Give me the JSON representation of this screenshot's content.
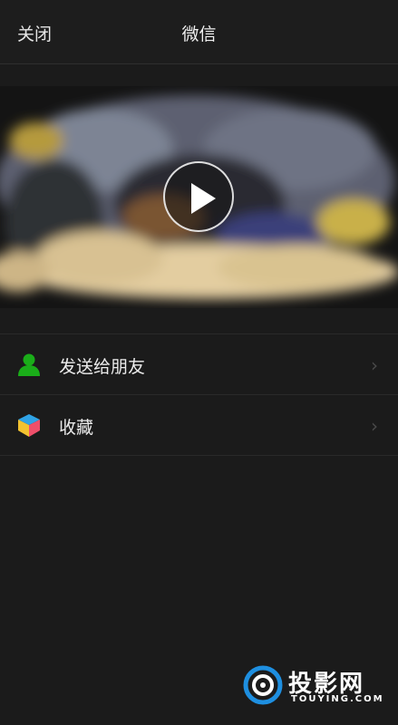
{
  "header": {
    "close_label": "关闭",
    "title": "微信"
  },
  "video": {
    "play_icon": "play-icon"
  },
  "menu": {
    "items": [
      {
        "label": "发送给朋友",
        "icon": "user-icon",
        "chevron": "›"
      },
      {
        "label": "收藏",
        "icon": "cube-icon",
        "chevron": "›"
      }
    ]
  },
  "watermark": {
    "text": "投影网",
    "sub": "TOUYING.COM"
  },
  "colors": {
    "background": "#1b1b1b",
    "user_icon_green": "#1aad19"
  }
}
